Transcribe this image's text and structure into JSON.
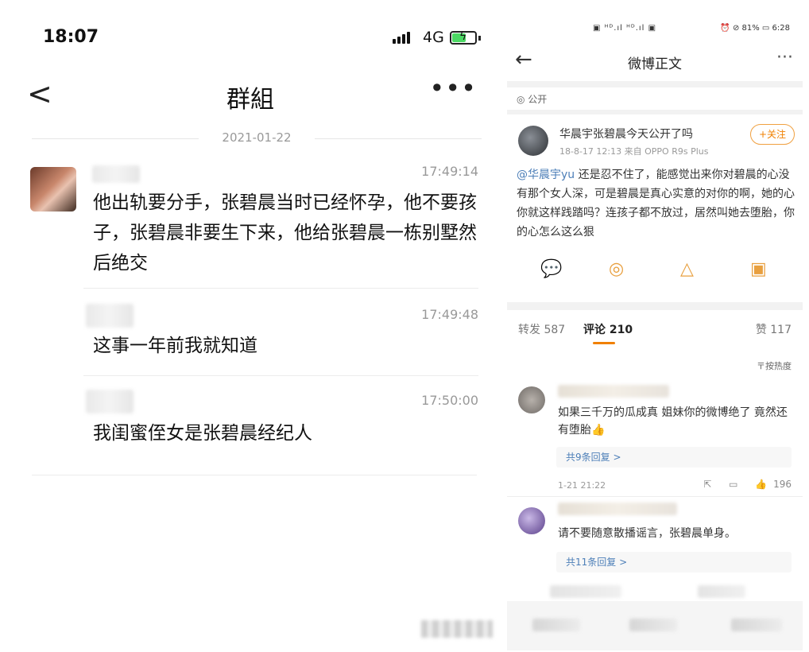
{
  "left_panel": {
    "status": {
      "time": "18:07",
      "network": "4G"
    },
    "nav": {
      "back": "<",
      "title": "群組",
      "more": "•••"
    },
    "date": "2021-01-22",
    "messages": [
      {
        "time": "17:49:14",
        "text": "他出轨要分手，张碧晨当时已经怀孕，他不要孩子，张碧晨非要生下来，他给张碧晨一栋别墅然后绝交"
      },
      {
        "time": "17:49:48",
        "text": "这事一年前我就知道"
      },
      {
        "time": "17:50:00",
        "text": "我闺蜜侄女是张碧晨经纪人"
      }
    ]
  },
  "right_panel": {
    "status": {
      "left": "▣ ᴴᴰ.ıl ᴴᴰ.ıl ▣",
      "right": "⏰ ⊘ 81% ▭ 6:28"
    },
    "nav": {
      "back": "←",
      "title": "微博正文",
      "more": "···"
    },
    "visibility": "公开",
    "post": {
      "user": "华晨宇张碧晨今天公开了吗",
      "meta": "18-8-17 12:13  来自 OPPO R9s Plus",
      "follow": "+关注",
      "mention": "@华晨宇yu",
      "body": " 还是忍不住了，能感觉出来你对碧晨的心没有那个女人深，可是碧晨是真心实意的对你的啊，她的心你就这样践踏吗？连孩子都不放过，居然叫她去堕胎，你的心怎么这么狠"
    },
    "share_icons": [
      "wechat-icon",
      "moments-icon",
      "qq-icon",
      "save-image-icon"
    ],
    "tabs": {
      "repost": "转发 587",
      "comments": "评论 210",
      "likes": "赞 117"
    },
    "sort": "〒按热度",
    "comments": [
      {
        "text": "如果三千万的瓜成真 姐妹你的微博绝了 竟然还有堕胎👍",
        "replies": "共9条回复 >",
        "date": "1-21 21:22",
        "likes": "196"
      },
      {
        "text": "请不要随意散播谣言，张碧晨单身。",
        "replies": "共11条回复 >"
      }
    ]
  }
}
